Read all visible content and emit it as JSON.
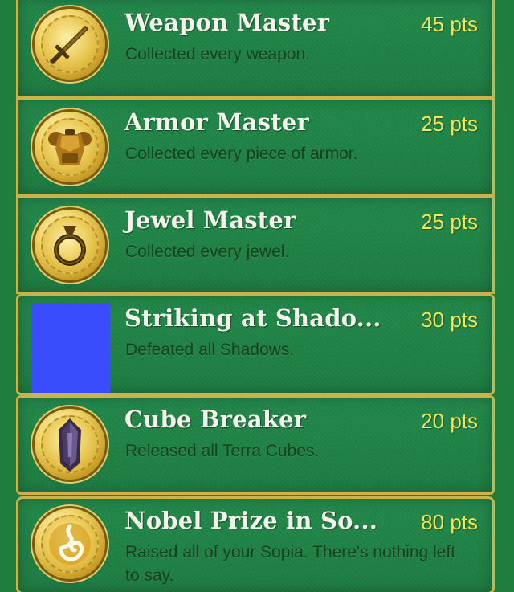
{
  "achievements": [
    {
      "title": "Weapon Master",
      "points": "45 pts",
      "description": "Collected every weapon.",
      "icon": "sword-icon"
    },
    {
      "title": "Armor Master",
      "points": "25 pts",
      "description": "Collected every piece of armor.",
      "icon": "armor-icon"
    },
    {
      "title": "Jewel Master",
      "points": "25 pts",
      "description": "Collected every jewel.",
      "icon": "ring-icon"
    },
    {
      "title": "Striking at Shado...",
      "points": "30 pts",
      "description": "Defeated all Shadows.",
      "icon": "placeholder-image"
    },
    {
      "title": "Cube Breaker",
      "points": "20 pts",
      "description": "Released all Terra Cubes.",
      "icon": "crystal-icon"
    },
    {
      "title": "Nobel Prize in So...",
      "points": "80 pts",
      "description": "Raised all of your Sopia. There's nothing left to say.",
      "icon": "flame-swirl-icon"
    }
  ],
  "colors": {
    "background": "#1f7e3e",
    "border": "#cbb24a",
    "title": "#f4f4ec",
    "points": "#f3e65a",
    "description": "#17401f",
    "placeholder": "#3a4dfd"
  }
}
